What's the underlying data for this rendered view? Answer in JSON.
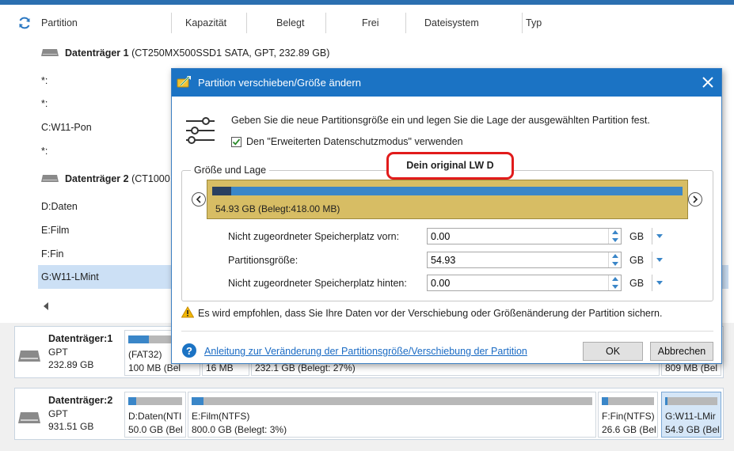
{
  "columns": [
    "Partition",
    "Kapazität",
    "Belegt",
    "Frei",
    "Dateisystem",
    "Typ"
  ],
  "partition_list": [
    {
      "kind": "disk",
      "name": "Datenträger 1",
      "info": "(CT250MX500SSD1 SATA, GPT, 232.89 GB)"
    },
    {
      "kind": "partition",
      "label": "*:"
    },
    {
      "kind": "partition",
      "label": "*:"
    },
    {
      "kind": "partition",
      "label": "C:W11-Pon"
    },
    {
      "kind": "partition",
      "label": "*:"
    },
    {
      "kind": "disk",
      "name": "Datenträger 2",
      "info": "(CT1000"
    },
    {
      "kind": "partition",
      "label": "D:Daten"
    },
    {
      "kind": "partition",
      "label": "E:Film"
    },
    {
      "kind": "partition",
      "label": "F:Fin"
    },
    {
      "kind": "partition",
      "label": "G:W11-LMint",
      "selected": true
    }
  ],
  "disk_map": [
    {
      "name": "Datenträger:1",
      "type": "GPT",
      "size": "232.89 GB",
      "partitions": [
        {
          "label": "(FAT32)",
          "size": "100 MB (Bel",
          "used_fraction": 0.3
        },
        {
          "label": "",
          "size": "16 MB",
          "used_fraction": 0.5
        },
        {
          "label": "",
          "size": "232.1 GB (Belegt: 27%)",
          "used_fraction": 0.27
        },
        {
          "label": "",
          "size": "809 MB (Bel",
          "used_fraction": 0.4
        }
      ]
    },
    {
      "name": "Datenträger:2",
      "type": "GPT",
      "size": "931.51 GB",
      "partitions": [
        {
          "label": "D:Daten(NTI",
          "size": "50.0 GB (Bel",
          "used_fraction": 0.15
        },
        {
          "label": "E:Film(NTFS)",
          "size": "800.0 GB (Belegt: 3%)",
          "used_fraction": 0.03
        },
        {
          "label": "F:Fin(NTFS)",
          "size": "26.6 GB (Bel",
          "used_fraction": 0.12
        },
        {
          "label": "G:W11-LMir",
          "size": "54.9 GB (Bel",
          "used_fraction": 0.05,
          "selected": true
        }
      ]
    }
  ],
  "dialog": {
    "title": "Partition verschieben/Größe ändern",
    "description": "Geben Sie die neue Partitionsgröße ein und legen Sie die Lage der ausgewählten Partition fest.",
    "checkbox_label": "Den \"Erweiterten Datenschutzmodus\" verwenden",
    "checkbox_checked": true,
    "group_title": "Größe und Lage",
    "annotation": "Dein original LW D",
    "partition_label": "54.93 GB (Belegt:418.00 MB)",
    "partition_used_fraction": 0.008,
    "fields": [
      {
        "label": "Nicht zugeordneter Speicherplatz vorn:",
        "value": "0.00",
        "unit": "GB"
      },
      {
        "label": "Partitionsgröße:",
        "value": "54.93",
        "unit": "GB"
      },
      {
        "label": "Nicht zugeordneter Speicherplatz hinten:",
        "value": "0.00",
        "unit": "GB"
      }
    ],
    "warning": "Es wird empfohlen, dass Sie Ihre Daten vor der Verschiebung oder Größenänderung der Partition sichern.",
    "help_link": "Anleitung zur Veränderung der Partitionsgröße/Verschiebung der Partition",
    "ok_label": "OK",
    "cancel_label": "Abbrechen"
  },
  "colors": {
    "accent": "#1b73c4",
    "partition_fill": "#d7bd64",
    "bar_blue": "#3a86c8",
    "annotation_red": "#e11b1b",
    "selection": "#cce0f5"
  },
  "icons": [
    "refresh-icon",
    "disk-icon",
    "move-resize-icon",
    "close-icon",
    "sliders-icon",
    "chevron-left-icon",
    "chevron-right-icon",
    "warning-icon",
    "help-icon",
    "dropdown-arrow-icon"
  ]
}
